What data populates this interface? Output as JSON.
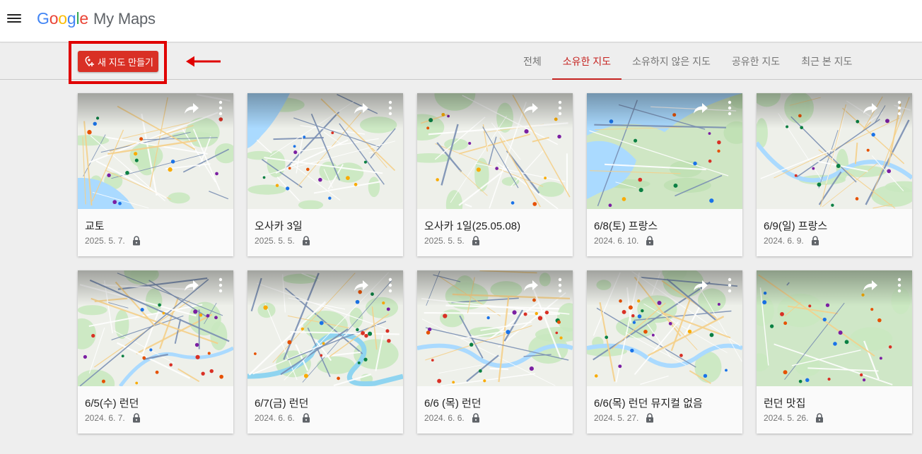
{
  "header": {
    "brand_letters": [
      "G",
      "o",
      "o",
      "g",
      "l",
      "e"
    ],
    "product": "My Maps",
    "menu_icon": "hamburger-menu-icon"
  },
  "toolbar": {
    "create_label": "새 지도 만들기",
    "create_icon": "add-map-icon",
    "accent": "#d93025",
    "annotation_color": "#e00000"
  },
  "tabs": [
    {
      "label": "전체",
      "active": false
    },
    {
      "label": "소유한 지도",
      "active": true
    },
    {
      "label": "소유하지 않은 지도",
      "active": false
    },
    {
      "label": "공유한 지도",
      "active": false
    },
    {
      "label": "최근 본 지도",
      "active": false
    }
  ],
  "maps": [
    {
      "title": "교토",
      "date": "2025. 5. 7.",
      "style": "kyoto"
    },
    {
      "title": "오사카 3일",
      "date": "2025. 5. 5.",
      "style": "osaka"
    },
    {
      "title": "오사카 1일(25.05.08)",
      "date": "2025. 5. 5.",
      "style": "osaka2"
    },
    {
      "title": "6/8(토) 프랑스",
      "date": "2024. 6. 10.",
      "style": "france"
    },
    {
      "title": "6/9(일) 프랑스",
      "date": "2024. 6. 9.",
      "style": "paris"
    },
    {
      "title": "6/5(수) 런던",
      "date": "2024. 6. 7.",
      "style": "london1"
    },
    {
      "title": "6/7(금) 런던",
      "date": "2024. 6. 6.",
      "style": "london2"
    },
    {
      "title": "6/6 (목) 런던",
      "date": "2024. 6. 6.",
      "style": "london3"
    },
    {
      "title": "6/6(목) 런던 뮤지컬 없음",
      "date": "2024. 5. 27.",
      "style": "london4"
    },
    {
      "title": "런던 맛집",
      "date": "2024. 5. 26.",
      "style": "london5"
    }
  ],
  "card_icons": [
    "share-icon",
    "more-vert-icon",
    "lock-icon"
  ]
}
